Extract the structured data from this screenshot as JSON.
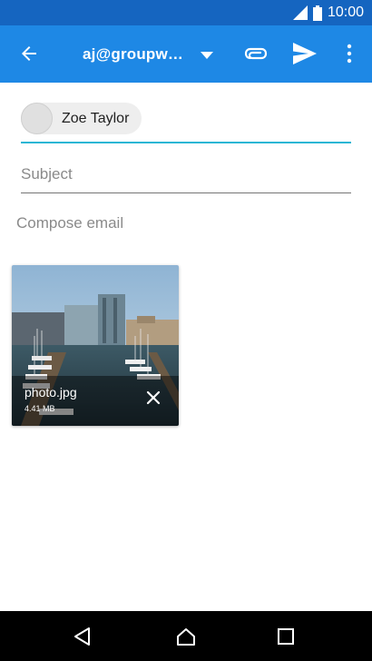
{
  "status_bar": {
    "time": "10:00"
  },
  "app_bar": {
    "from_account": "aj@groupw…"
  },
  "compose": {
    "to_chip_name": "Zoe Taylor",
    "subject_placeholder": "Subject",
    "body_placeholder": "Compose email"
  },
  "attachment": {
    "file_name": "photo.jpg",
    "file_size": "4.41 MB"
  },
  "colors": {
    "status_bar": "#1565c0",
    "app_bar": "#1e88e5",
    "to_underline": "#26b6d4"
  }
}
